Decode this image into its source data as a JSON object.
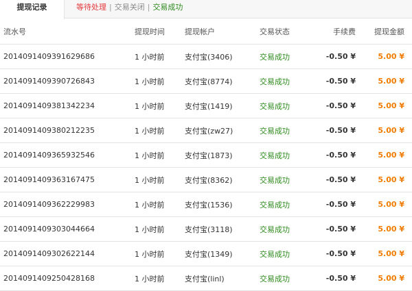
{
  "tabs": {
    "title": "提现记录"
  },
  "filters": {
    "pending": "等待处理",
    "closed": "交易关闭",
    "success": "交易成功",
    "separator": "|"
  },
  "columns": {
    "serial": "流水号",
    "time": "提现时间",
    "account": "提现帐户",
    "status": "交易状态",
    "fee": "手续费",
    "amount": "提现金额"
  },
  "rows": [
    {
      "serial": "2014091409391629686",
      "time": "1 小时前",
      "account": "支付宝(3406)",
      "status": "交易成功",
      "fee": "-0.50 ¥",
      "amount": "5.00 ¥"
    },
    {
      "serial": "2014091409390726843",
      "time": "1 小时前",
      "account": "支付宝(8774)",
      "status": "交易成功",
      "fee": "-0.50 ¥",
      "amount": "5.00 ¥"
    },
    {
      "serial": "2014091409381342234",
      "time": "1 小时前",
      "account": "支付宝(1419)",
      "status": "交易成功",
      "fee": "-0.50 ¥",
      "amount": "5.00 ¥"
    },
    {
      "serial": "2014091409380212235",
      "time": "1 小时前",
      "account": "支付宝(zw27)",
      "status": "交易成功",
      "fee": "-0.50 ¥",
      "amount": "5.00 ¥"
    },
    {
      "serial": "2014091409365932546",
      "time": "1 小时前",
      "account": "支付宝(1873)",
      "status": "交易成功",
      "fee": "-0.50 ¥",
      "amount": "5.00 ¥"
    },
    {
      "serial": "2014091409363167475",
      "time": "1 小时前",
      "account": "支付宝(8362)",
      "status": "交易成功",
      "fee": "-0.50 ¥",
      "amount": "5.00 ¥"
    },
    {
      "serial": "2014091409362229983",
      "time": "1 小时前",
      "account": "支付宝(1536)",
      "status": "交易成功",
      "fee": "-0.50 ¥",
      "amount": "5.00 ¥"
    },
    {
      "serial": "2014091409303044664",
      "time": "1 小时前",
      "account": "支付宝(3118)",
      "status": "交易成功",
      "fee": "-0.50 ¥",
      "amount": "5.00 ¥"
    },
    {
      "serial": "2014091409302622144",
      "time": "1 小时前",
      "account": "支付宝(1349)",
      "status": "交易成功",
      "fee": "-0.50 ¥",
      "amount": "5.00 ¥"
    },
    {
      "serial": "2014091409250428168",
      "time": "1 小时前",
      "account": "支付宝(linl)",
      "status": "交易成功",
      "fee": "-0.50 ¥",
      "amount": "5.00 ¥"
    }
  ],
  "colors": {
    "pending": "#e4393c",
    "closed": "#888888",
    "success": "#2e8b1e",
    "amount": "#f07c00"
  }
}
